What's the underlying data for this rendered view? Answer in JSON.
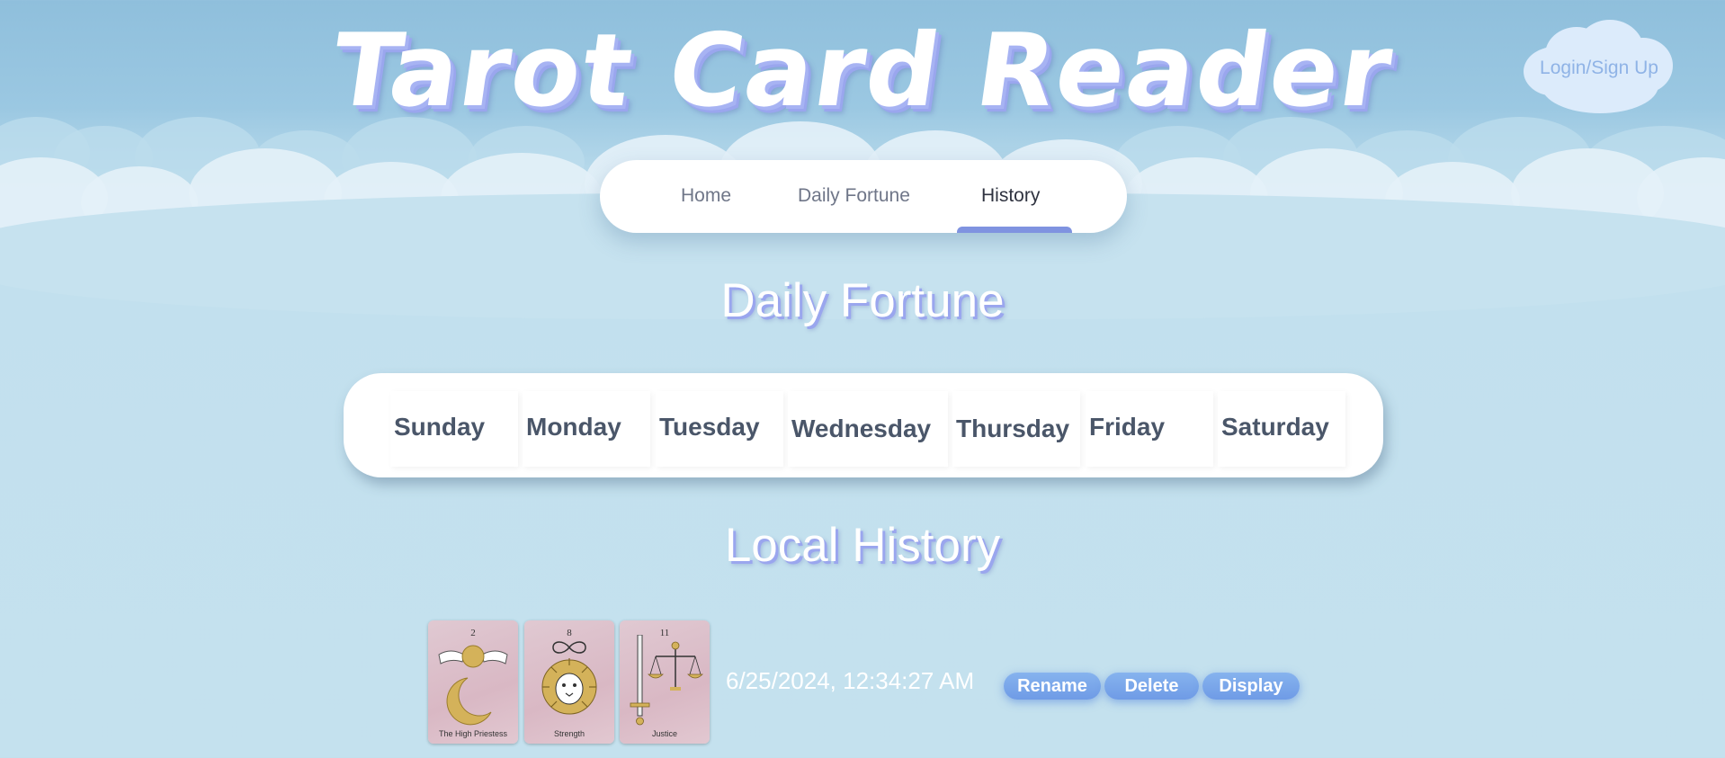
{
  "app": {
    "title": "Tarot Card Reader",
    "login_label": "Login/Sign Up"
  },
  "nav": {
    "items": [
      {
        "label": "Home"
      },
      {
        "label": "Daily Fortune"
      },
      {
        "label": "History",
        "active": true
      }
    ]
  },
  "daily": {
    "title": "Daily Fortune",
    "days": [
      "Sunday",
      "Monday",
      "Tuesday",
      "Wednesday",
      "Thursday",
      "Friday",
      "Saturday"
    ]
  },
  "history": {
    "title": "Local History",
    "entries": [
      {
        "cards": [
          {
            "number": "2",
            "name": "The High Priestess",
            "icon": "moon-priestess-icon"
          },
          {
            "number": "8",
            "name": "Strength",
            "icon": "lion-icon"
          },
          {
            "number": "11",
            "name": "Justice",
            "icon": "scales-sword-icon"
          }
        ],
        "timestamp": "6/25/2024, 12:34:27 AM",
        "actions": {
          "rename": "Rename",
          "delete": "Delete",
          "display": "Display"
        }
      }
    ]
  },
  "colors": {
    "accent": "#7f93e0",
    "title_shadow": "#9aa6ee",
    "button": "#7aa6ea",
    "card_bg": "#ddc0cb",
    "gold": "#d4b25a"
  }
}
